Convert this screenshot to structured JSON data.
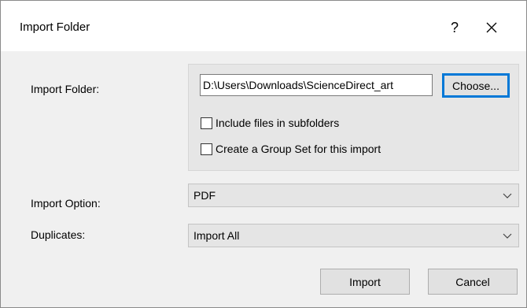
{
  "dialog": {
    "title": "Import Folder",
    "help_label": "?",
    "close_icon": "close-icon"
  },
  "folder": {
    "label": "Import Folder:",
    "path_value": "D:\\Users\\Downloads\\ScienceDirect_art",
    "choose_label": "Choose...",
    "include_subfolders": {
      "label": "Include files in subfolders",
      "checked": false
    },
    "create_group_set": {
      "label": "Create a Group Set for this import",
      "checked": false
    }
  },
  "import_option": {
    "label": "Import Option:",
    "value": "PDF"
  },
  "duplicates": {
    "label": "Duplicates:",
    "value": "Import All"
  },
  "footer": {
    "import_label": "Import",
    "cancel_label": "Cancel"
  },
  "colors": {
    "focus_border": "#0078d7",
    "dialog_bg": "#f0f0f0"
  }
}
